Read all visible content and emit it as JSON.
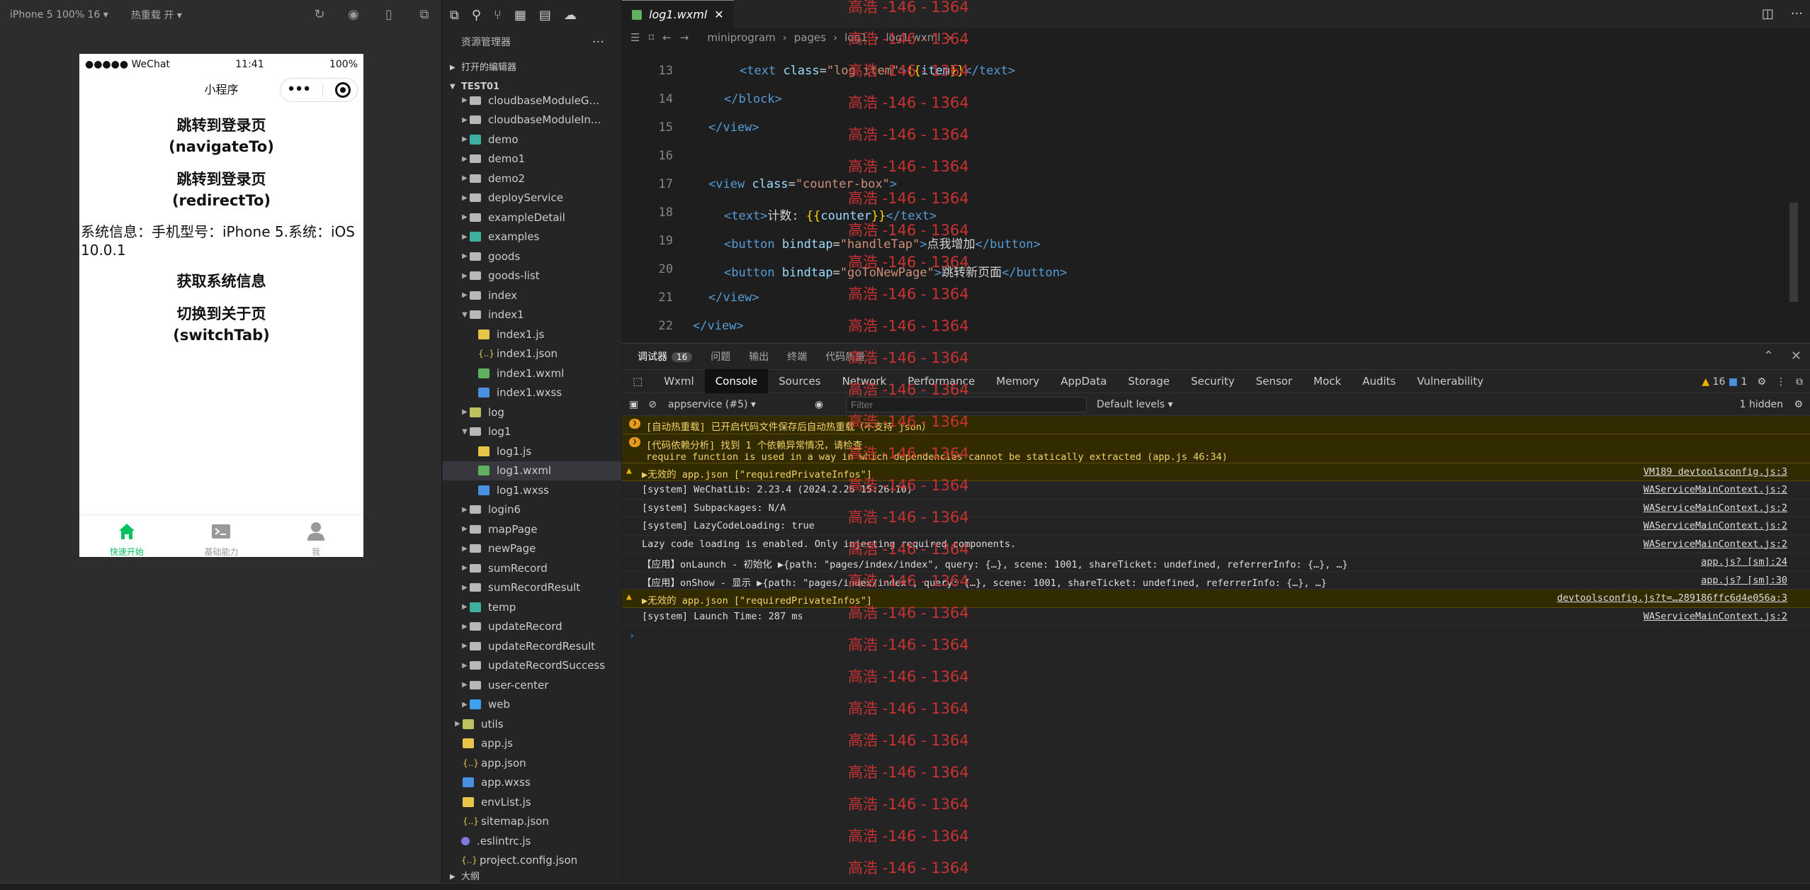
{
  "simulator": {
    "device_label": "iPhone 5 100% 16 ▾",
    "hot_reload_label": "热重载 开 ▾",
    "status": {
      "carrier": "●●●●● WeChat",
      "time": "11:41",
      "battery": "100%"
    },
    "nav_title": "小程序",
    "buttons": [
      "跳转到登录页\n(navigateTo)",
      "跳转到登录页\n(redirectTo)"
    ],
    "sysinfo": "系统信息：手机型号：iPhone 5.系统：iOS 10.0.1",
    "buttons2": [
      "获取系统信息",
      "切换到关于页\n(switchTab)"
    ],
    "tabbar": [
      {
        "label": "快速开始",
        "icon": "home-icon",
        "active": true
      },
      {
        "label": "基础能力",
        "icon": "terminal-icon",
        "active": false
      },
      {
        "label": "我",
        "icon": "user-icon",
        "active": false
      }
    ]
  },
  "explorer": {
    "title": "资源管理器",
    "sections": {
      "open_editors": "打开的编辑器",
      "project": "TEST01",
      "outline": "大纲"
    },
    "tree": [
      {
        "name": "cloudbaseModuleG...",
        "type": "folder",
        "depth": 1,
        "open": false
      },
      {
        "name": "cloudbaseModuleIn...",
        "type": "folder",
        "depth": 1,
        "open": false
      },
      {
        "name": "demo",
        "type": "folder-g",
        "depth": 1,
        "open": false
      },
      {
        "name": "demo1",
        "type": "folder",
        "depth": 1,
        "open": false
      },
      {
        "name": "demo2",
        "type": "folder",
        "depth": 1,
        "open": false
      },
      {
        "name": "deployService",
        "type": "folder",
        "depth": 1,
        "open": false
      },
      {
        "name": "exampleDetail",
        "type": "folder",
        "depth": 1,
        "open": false
      },
      {
        "name": "examples",
        "type": "folder-g",
        "depth": 1,
        "open": false
      },
      {
        "name": "goods",
        "type": "folder",
        "depth": 1,
        "open": false
      },
      {
        "name": "goods-list",
        "type": "folder",
        "depth": 1,
        "open": false
      },
      {
        "name": "index",
        "type": "folder",
        "depth": 1,
        "open": false
      },
      {
        "name": "index1",
        "type": "folder",
        "depth": 1,
        "open": true
      },
      {
        "name": "index1.js",
        "type": "js",
        "depth": 2
      },
      {
        "name": "index1.json",
        "type": "json",
        "depth": 2
      },
      {
        "name": "index1.wxml",
        "type": "wxml",
        "depth": 2
      },
      {
        "name": "index1.wxss",
        "type": "wxss",
        "depth": 2
      },
      {
        "name": "log",
        "type": "folder-y",
        "depth": 1,
        "open": false
      },
      {
        "name": "log1",
        "type": "folder",
        "depth": 1,
        "open": true
      },
      {
        "name": "log1.js",
        "type": "js",
        "depth": 2
      },
      {
        "name": "log1.wxml",
        "type": "wxml",
        "depth": 2,
        "selected": true
      },
      {
        "name": "log1.wxss",
        "type": "wxss",
        "depth": 2
      },
      {
        "name": "login6",
        "type": "folder",
        "depth": 1,
        "open": false
      },
      {
        "name": "mapPage",
        "type": "folder",
        "depth": 1,
        "open": false
      },
      {
        "name": "newPage",
        "type": "folder",
        "depth": 1,
        "open": false
      },
      {
        "name": "sumRecord",
        "type": "folder",
        "depth": 1,
        "open": false
      },
      {
        "name": "sumRecordResult",
        "type": "folder",
        "depth": 1,
        "open": false
      },
      {
        "name": "temp",
        "type": "folder-g",
        "depth": 1,
        "open": false
      },
      {
        "name": "updateRecord",
        "type": "folder",
        "depth": 1,
        "open": false
      },
      {
        "name": "updateRecordResult",
        "type": "folder",
        "depth": 1,
        "open": false
      },
      {
        "name": "updateRecordSuccess",
        "type": "folder",
        "depth": 1,
        "open": false
      },
      {
        "name": "user-center",
        "type": "folder",
        "depth": 1,
        "open": false
      },
      {
        "name": "web",
        "type": "folder-b",
        "depth": 1,
        "open": false
      },
      {
        "name": "utils",
        "type": "folder-y",
        "depth": 0,
        "open": false
      },
      {
        "name": "app.js",
        "type": "js",
        "depth": 0
      },
      {
        "name": "app.json",
        "type": "json",
        "depth": 0
      },
      {
        "name": "app.wxss",
        "type": "wxss",
        "depth": 0
      },
      {
        "name": "envList.js",
        "type": "js",
        "depth": 0
      },
      {
        "name": "sitemap.json",
        "type": "json",
        "depth": 0
      },
      {
        "name": ".eslintrc.js",
        "type": "dot",
        "depth": -1
      },
      {
        "name": "project.config.json",
        "type": "json",
        "depth": -1
      }
    ]
  },
  "editor": {
    "tab_label": "log1.wxml",
    "breadcrumb": [
      "miniprogram",
      "pages",
      "log1",
      "log1.wxml",
      "..."
    ],
    "lines": [
      {
        "n": "13",
        "indent": 2,
        "html": "<span class=\"tag\">&lt;text</span> <span class=\"attr\">class</span>=<span class=\"str\">\"log-item\"</span><span class=\"tag\">&gt;</span><span class=\"mus\">{{</span><span class=\"var\">item</span><span class=\"mus\">}}</span><span class=\"tag\">&lt;/text&gt;</span>"
      },
      {
        "n": "14",
        "indent": 1,
        "html": "<span class=\"tag\">&lt;/block&gt;</span>"
      },
      {
        "n": "15",
        "indent": 0,
        "html": "<span class=\"tag\">&lt;/view&gt;</span>"
      },
      {
        "n": "16",
        "indent": 0,
        "html": ""
      },
      {
        "n": "17",
        "indent": 0,
        "html": "<span class=\"tag\">&lt;view</span> <span class=\"attr\">class</span>=<span class=\"str\">\"counter-box\"</span><span class=\"tag\">&gt;</span>"
      },
      {
        "n": "18",
        "indent": 1,
        "html": "<span class=\"tag\">&lt;text&gt;</span><span class=\"txt\">计数: </span><span class=\"mus\">{{</span><span class=\"var\">counter</span><span class=\"mus\">}}</span><span class=\"tag\">&lt;/text&gt;</span>"
      },
      {
        "n": "19",
        "indent": 1,
        "html": "<span class=\"tag\">&lt;button</span> <span class=\"attr\">bindtap</span>=<span class=\"str\">\"handleTap\"</span><span class=\"tag\">&gt;</span><span class=\"txt\">点我增加</span><span class=\"tag\">&lt;/button&gt;</span>"
      },
      {
        "n": "20",
        "indent": 1,
        "html": "<span class=\"tag\">&lt;button</span> <span class=\"attr\">bindtap</span>=<span class=\"str\">\"goToNewPage\"</span><span class=\"tag\">&gt;</span><span class=\"txt\">跳转新页面</span><span class=\"tag\">&lt;/button&gt;</span>"
      },
      {
        "n": "21",
        "indent": 0,
        "html": "<span class=\"tag\">&lt;/view&gt;</span>"
      },
      {
        "n": "22",
        "indent": -1,
        "html": "<span class=\"tag\">&lt;/view&gt;</span>"
      }
    ]
  },
  "panel": {
    "tabs": [
      "调试器",
      "问题",
      "输出",
      "终端",
      "代码质量"
    ],
    "debugger_badge": "16",
    "devtools_tabs": [
      "Wxml",
      "Console",
      "Sources",
      "Network",
      "Performance",
      "Memory",
      "AppData",
      "Storage",
      "Security",
      "Sensor",
      "Mock",
      "Audits",
      "Vulnerability"
    ],
    "warn_count": "16",
    "msg_count": "1",
    "context": "appservice (#5)",
    "filter_placeholder": "Filter",
    "levels": "Default levels ▾",
    "hidden": "1 hidden",
    "console": [
      {
        "kind": "warn-badge",
        "text": "[自动热重载] 已开启代码文件保存后自动热重载（不支持 json）",
        "src": ""
      },
      {
        "kind": "warn-badge",
        "text": "[代码依赖分析] 找到 1 个依赖异常情况，请检查\nrequire function is used in a way in which dependencies cannot be statically extracted (app.js 46:34)",
        "src": ""
      },
      {
        "kind": "warn",
        "text": "▶无效的 app.json [\"requiredPrivateInfos\"]",
        "src": "VM189 devtoolsconfig.js:3"
      },
      {
        "kind": "log",
        "text": "[system] WeChatLib: 2.23.4 (2024.2.26 15:26:10)",
        "src": "WAServiceMainContext.js:2"
      },
      {
        "kind": "log",
        "text": "[system] Subpackages: N/A",
        "src": "WAServiceMainContext.js:2"
      },
      {
        "kind": "log",
        "text": "[system] LazyCodeLoading: true",
        "src": "WAServiceMainContext.js:2"
      },
      {
        "kind": "log",
        "text": "Lazy code loading is enabled. Only injecting required components.",
        "src": "WAServiceMainContext.js:2"
      },
      {
        "kind": "log",
        "text": "【应用】onLaunch - 初始化 ▶{path: \"pages/index/index\", query: {…}, scene: 1001, shareTicket: undefined, referrerInfo: {…}, …}",
        "src": "app.js? [sm]:24"
      },
      {
        "kind": "log",
        "text": "【应用】onShow - 显示 ▶{path: \"pages/index/index\", query: {…}, scene: 1001, shareTicket: undefined, referrerInfo: {…}, …}",
        "src": "app.js? [sm]:30"
      },
      {
        "kind": "warn",
        "text": "▶无效的 app.json [\"requiredPrivateInfos\"]",
        "src": "devtoolsconfig.js?t=…289186ffc6d4e056a:3"
      },
      {
        "kind": "log",
        "text": "[system] Launch Time: 287 ms",
        "src": "WAServiceMainContext.js:2"
      }
    ]
  },
  "watermark": "高浩 -146 - 1364",
  "colors": {
    "accent_green": "#07c160",
    "warn_bg": "#332b00",
    "watermark": "#c83232"
  }
}
